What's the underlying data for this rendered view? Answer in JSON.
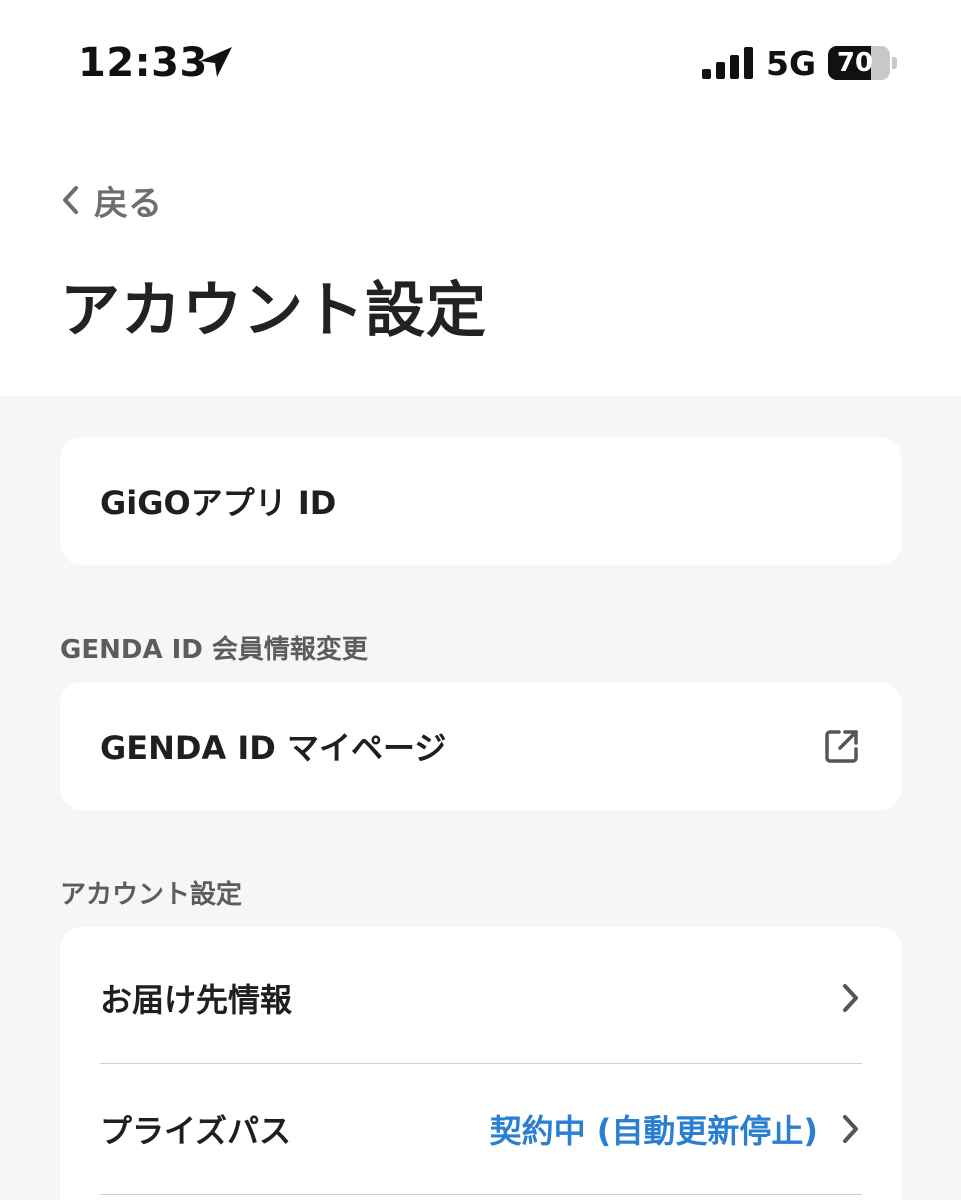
{
  "status_bar": {
    "time": "12:33",
    "network": "5G",
    "battery_level": "70",
    "battery_fraction": 0.7
  },
  "header": {
    "back_label": "戻る",
    "title": "アカウント設定"
  },
  "gigo_card": {
    "label": "GiGOアプリ ID"
  },
  "genda_section": {
    "heading": "GENDA ID 会員情報変更",
    "item_label": "GENDA ID マイページ",
    "item_icon": "external-link-icon"
  },
  "account_section": {
    "heading": "アカウント設定",
    "items": [
      {
        "label": "お届け先情報",
        "value": "",
        "icon": "chevron-right-icon"
      },
      {
        "label": "プライズパス",
        "value": "契約中 (自動更新停止)",
        "icon": "chevron-right-icon"
      }
    ]
  },
  "colors": {
    "background": "#f5f6f8",
    "card": "#ffffff",
    "accent_link": "#2a7fd0",
    "muted_text": "#6e6e6e"
  }
}
